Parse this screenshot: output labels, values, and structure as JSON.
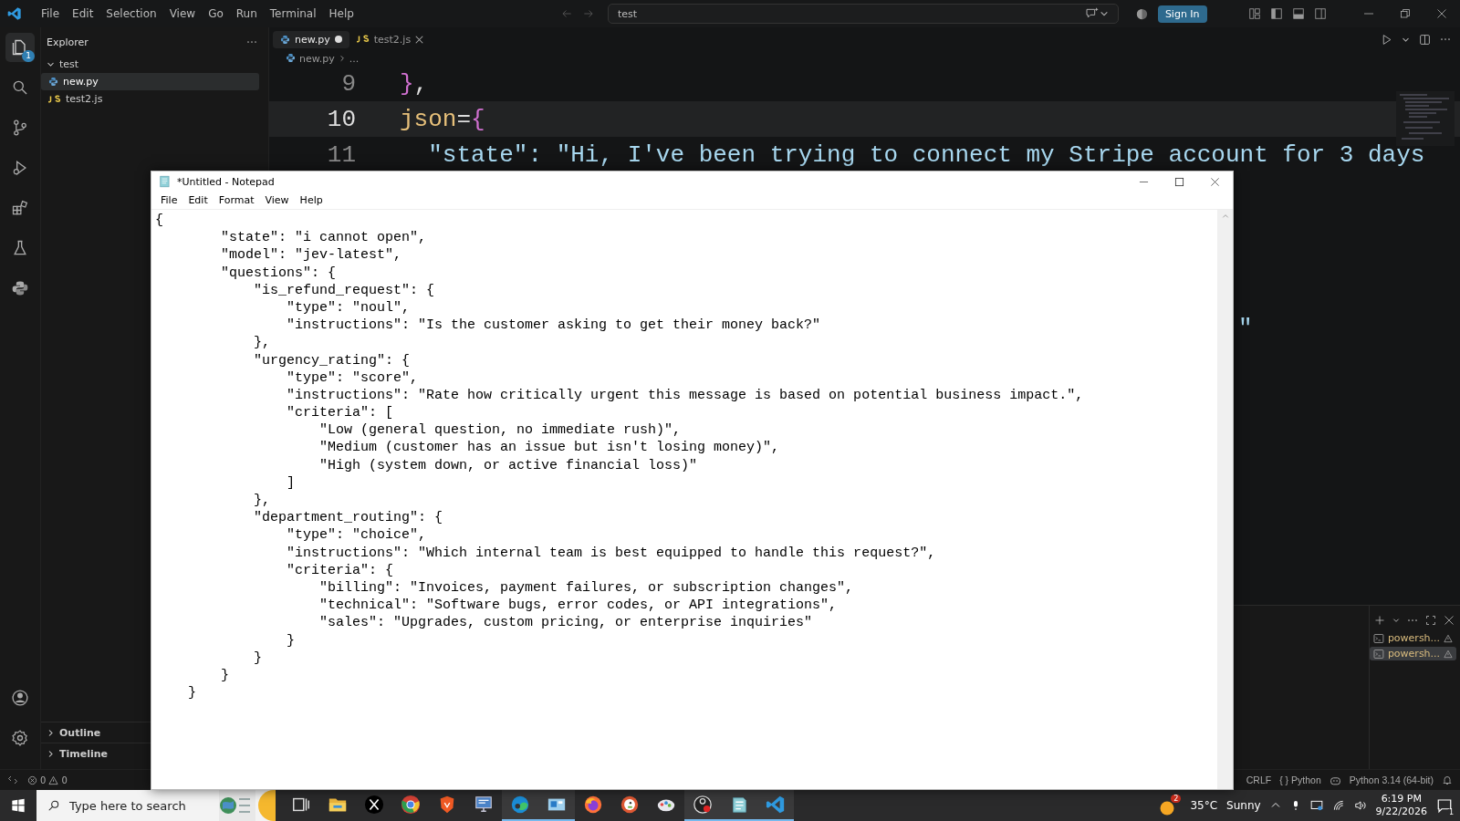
{
  "title_bar": {
    "menu": [
      "File",
      "Edit",
      "Selection",
      "View",
      "Go",
      "Run",
      "Terminal",
      "Help"
    ],
    "search": "test",
    "sign_in": "Sign In"
  },
  "activity_bar": {
    "items": [
      {
        "kind": "explorer",
        "selected": true,
        "badge": "1"
      },
      {
        "kind": "search",
        "selected": false
      },
      {
        "kind": "source-control",
        "selected": false
      },
      {
        "kind": "run",
        "selected": false
      },
      {
        "kind": "extensions",
        "selected": false
      },
      {
        "kind": "testing",
        "selected": false
      },
      {
        "kind": "python",
        "selected": false
      }
    ],
    "bottom": [
      {
        "kind": "account"
      },
      {
        "kind": "settings"
      }
    ]
  },
  "explorer": {
    "title": "Explorer",
    "folder": {
      "label": "test",
      "expanded": true,
      "children": [
        {
          "label": "new.py",
          "kind": "python",
          "selected": true
        },
        {
          "label": "test2.js",
          "kind": "js",
          "selected": false
        }
      ]
    },
    "sections": [
      {
        "label": "Outline",
        "expanded": false
      },
      {
        "label": "Timeline",
        "expanded": false
      }
    ]
  },
  "editor": {
    "tabs": [
      {
        "label": "new.py",
        "kind": "python",
        "selected": true,
        "modified": true
      },
      {
        "label": "test2.js",
        "kind": "js",
        "selected": false,
        "modified": false
      }
    ],
    "breadcrumb": [
      {
        "label": "new.py",
        "kind": "python"
      },
      {
        "label": "...",
        "kind": "more"
      }
    ],
    "lines": [
      {
        "number": "9",
        "current": false,
        "tokens": [
          {
            "kind": "brace",
            "text": "}"
          },
          {
            "kind": "punct",
            "text": ","
          }
        ]
      },
      {
        "number": "10",
        "current": true,
        "tokens": [
          {
            "kind": "name",
            "text": "json"
          },
          {
            "kind": "punct",
            "text": "="
          },
          {
            "kind": "brace",
            "text": "{"
          }
        ]
      },
      {
        "number": "11",
        "current": false,
        "tokens": [
          {
            "kind": "string",
            "text": "  \"state\": \"Hi, I've been trying to connect my Stripe account for 3 days"
          }
        ]
      }
    ],
    "hidden_line_tail": "\""
  },
  "terminal_panel": {
    "terminals": [
      {
        "label": "powersh...",
        "selected": false
      },
      {
        "label": "powersh...",
        "selected": true
      }
    ]
  },
  "status_bar": {
    "errors": "0",
    "warnings": "0",
    "eol": "CRLF",
    "language_icon": "{ }",
    "language": "Python",
    "interpreter": "Python 3.14 (64-bit)"
  },
  "notepad": {
    "title": "*Untitled - Notepad",
    "menu": [
      "File",
      "Edit",
      "Format",
      "View",
      "Help"
    ],
    "lines": [
      "{",
      "        \"state\": \"i cannot open\",",
      "        \"model\": \"jev-latest\",",
      "        \"questions\": {",
      "            \"is_refund_request\": {",
      "                \"type\": \"noul\",",
      "                \"instructions\": \"Is the customer asking to get their money back?\"",
      "            },",
      "            \"urgency_rating\": {",
      "                \"type\": \"score\",",
      "                \"instructions\": \"Rate how critically urgent this message is based on potential business impact.\",",
      "                \"criteria\": [",
      "                    \"Low (general question, no immediate rush)\",",
      "                    \"Medium (customer has an issue but isn't losing money)\",",
      "                    \"High (system down, or active financial loss)\"",
      "                ]",
      "            },",
      "            \"department_routing\": {",
      "                \"type\": \"choice\",",
      "                \"instructions\": \"Which internal team is best equipped to handle this request?\",",
      "                \"criteria\": {",
      "                    \"billing\": \"Invoices, payment failures, or subscription changes\",",
      "                    \"technical\": \"Software bugs, error codes, or API integrations\",",
      "                    \"sales\": \"Upgrades, custom pricing, or enterprise inquiries\"",
      "                }",
      "            }",
      "        }",
      "    }"
    ]
  },
  "taskbar": {
    "search_placeholder": "Type here to search",
    "apps": [
      {
        "kind": "task-view",
        "active": false
      },
      {
        "kind": "folder",
        "active": false
      },
      {
        "kind": "x",
        "active": false
      },
      {
        "kind": "chrome",
        "active": false
      },
      {
        "kind": "brave",
        "active": false
      },
      {
        "kind": "monitor",
        "active": false
      },
      {
        "kind": "edge",
        "active": true
      },
      {
        "kind": "window",
        "active": true
      },
      {
        "kind": "firefox",
        "active": false
      },
      {
        "kind": "duck",
        "active": false
      },
      {
        "kind": "paint",
        "active": false
      },
      {
        "kind": "obs",
        "active": true
      },
      {
        "kind": "notepad",
        "active": true
      },
      {
        "kind": "vscode",
        "active": true
      }
    ],
    "weather": {
      "badge": "2",
      "temperature": "35°C",
      "condition": "Sunny"
    },
    "time": "6:19 PM",
    "date": "9/22/2026",
    "notifications": "1"
  }
}
